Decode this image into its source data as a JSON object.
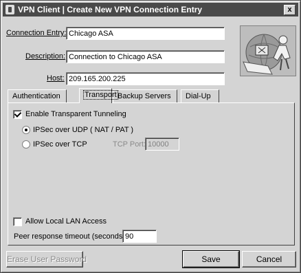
{
  "window": {
    "title": "VPN Client  |  Create New VPN Connection Entry",
    "close_label": "x"
  },
  "form": {
    "connection_entry_label": "Connection Entry:",
    "connection_entry_value": "Chicago ASA",
    "description_label": "Description:",
    "description_value": "Connection to Chicago ASA",
    "host_label": "Host:",
    "host_value": "209.165.200.225"
  },
  "tabs": [
    {
      "label": "Authentication",
      "active": false
    },
    {
      "label": "Transport",
      "active": true
    },
    {
      "label": "Backup Servers",
      "active": false
    },
    {
      "label": "Dial-Up",
      "active": false
    }
  ],
  "transport": {
    "enable_tunneling_label": "Enable Transparent Tunneling",
    "enable_tunneling_checked": true,
    "ipsec_udp_label": "IPSec over UDP ( NAT / PAT )",
    "ipsec_udp_selected": true,
    "ipsec_tcp_label": "IPSec over TCP",
    "ipsec_tcp_selected": false,
    "tcp_port_label": "TCP Port:",
    "tcp_port_value": "10000",
    "allow_lan_label": "Allow Local LAN Access",
    "allow_lan_checked": false,
    "peer_timeout_label": "Peer response timeout (seconds):",
    "peer_timeout_value": "90"
  },
  "buttons": {
    "erase_password": "Erase User Password",
    "save": "Save",
    "cancel": "Cancel"
  }
}
